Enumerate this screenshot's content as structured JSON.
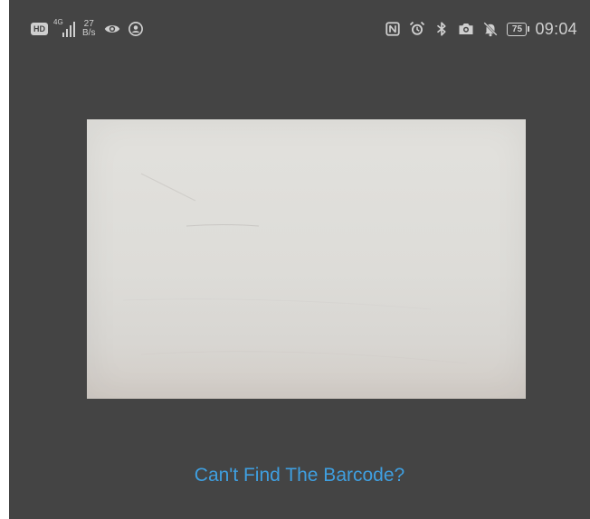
{
  "status_bar": {
    "hd_label": "HD",
    "network_gen": "4G",
    "speed_value": "27",
    "speed_unit": "B/s",
    "battery_level": "75",
    "time": "09:04",
    "left_icons": [
      "hd-icon",
      "signal-icon",
      "eye-icon",
      "location-icon"
    ],
    "right_icons": [
      "nfc-icon",
      "alarm-icon",
      "bluetooth-icon",
      "camera-icon",
      "mute-icon",
      "battery-icon"
    ]
  },
  "scanner": {
    "link_text": "Can't Find The Barcode?",
    "link_color": "#3f9fe0",
    "background_color": "#444444"
  }
}
